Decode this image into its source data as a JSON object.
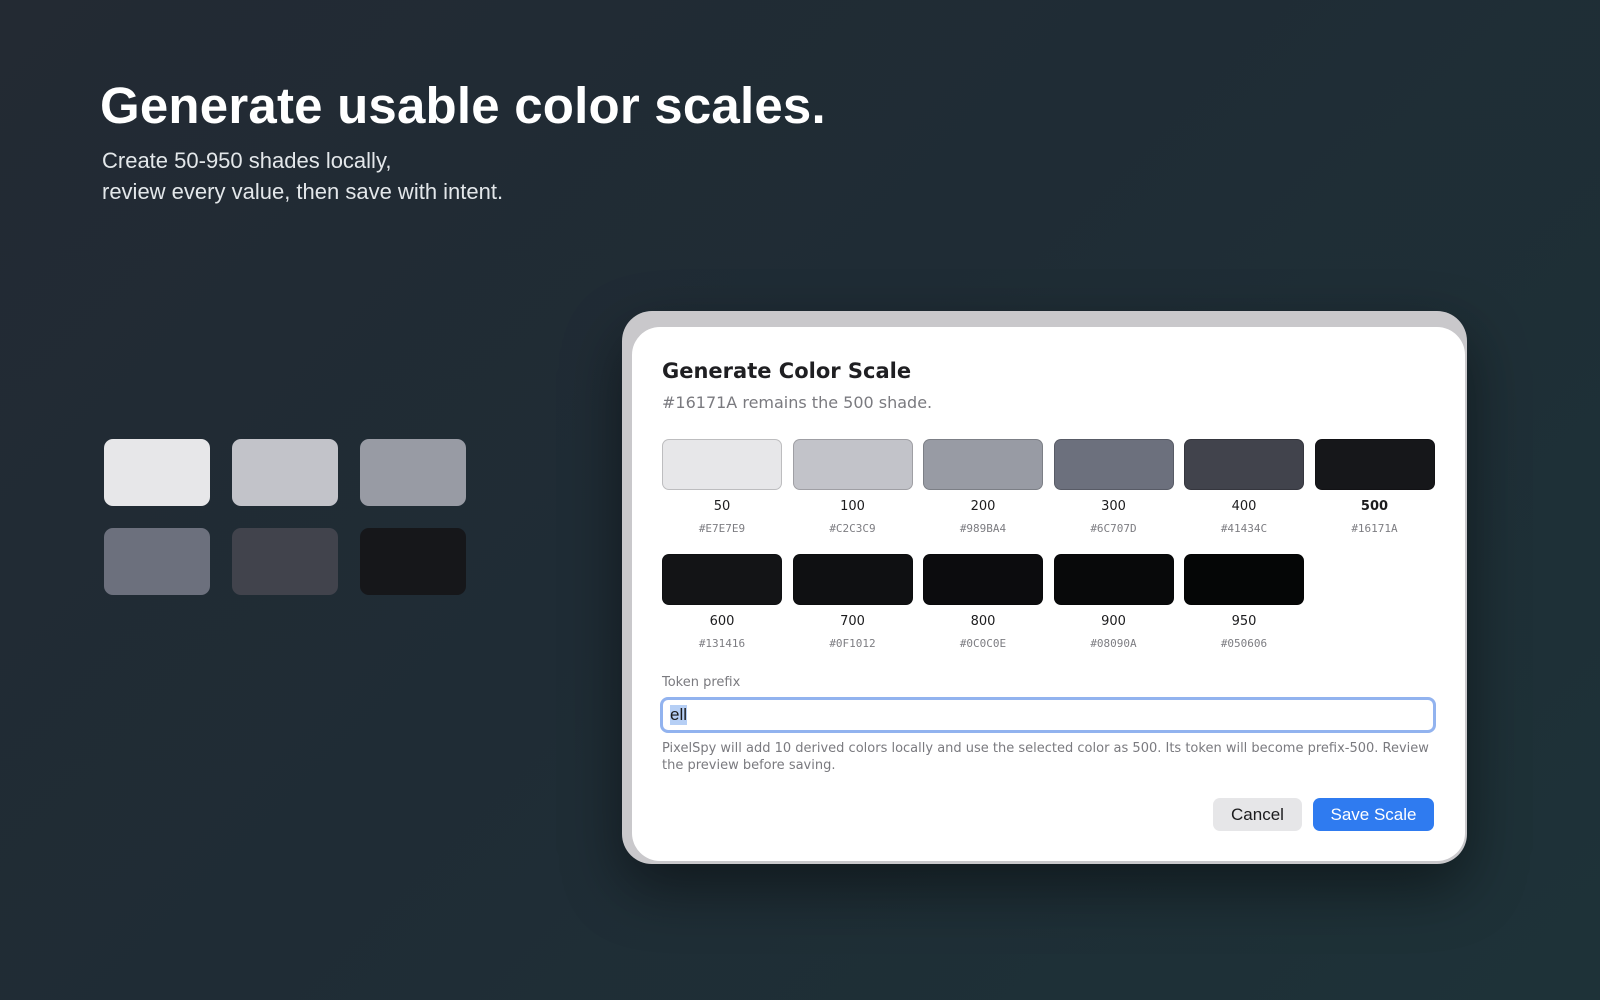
{
  "hero": {
    "title": "Generate usable color scales.",
    "subtitle_line1": "Create 50-950 shades locally,",
    "subtitle_line2": "review every value, then save with intent."
  },
  "preview_tiles": [
    "#E7E7E9",
    "#C2C3C9",
    "#989BA4",
    "#6C707D",
    "#41434C",
    "#16171A"
  ],
  "dialog": {
    "title": "Generate Color Scale",
    "subtitle": "#16171A remains the 500 shade.",
    "swatches": [
      {
        "name": "50",
        "hex": "#E7E7E9",
        "color": "#E7E7E9",
        "selected": false
      },
      {
        "name": "100",
        "hex": "#C2C3C9",
        "color": "#C2C3C9",
        "selected": false
      },
      {
        "name": "200",
        "hex": "#989BA4",
        "color": "#989BA4",
        "selected": false
      },
      {
        "name": "300",
        "hex": "#6C707D",
        "color": "#6C707D",
        "selected": false
      },
      {
        "name": "400",
        "hex": "#41434C",
        "color": "#41434C",
        "selected": false
      },
      {
        "name": "500",
        "hex": "#16171A",
        "color": "#16171A",
        "selected": true
      },
      {
        "name": "600",
        "hex": "#131416",
        "color": "#131416",
        "selected": false
      },
      {
        "name": "700",
        "hex": "#0F1012",
        "color": "#0F1012",
        "selected": false
      },
      {
        "name": "800",
        "hex": "#0C0C0E",
        "color": "#0C0C0E",
        "selected": false
      },
      {
        "name": "900",
        "hex": "#08090A",
        "color": "#08090A",
        "selected": false
      },
      {
        "name": "950",
        "hex": "#050606",
        "color": "#050606",
        "selected": false
      }
    ],
    "token_label": "Token prefix",
    "token_value": "ell",
    "help_text": "PixelSpy will add 10 derived colors locally and use the selected color as 500. Its token will become prefix-500. Review the preview before saving.",
    "cancel_label": "Cancel",
    "save_label": "Save Scale"
  },
  "colors": {
    "accent": "#2F7BF0",
    "focus_ring": "#92B3EF"
  }
}
